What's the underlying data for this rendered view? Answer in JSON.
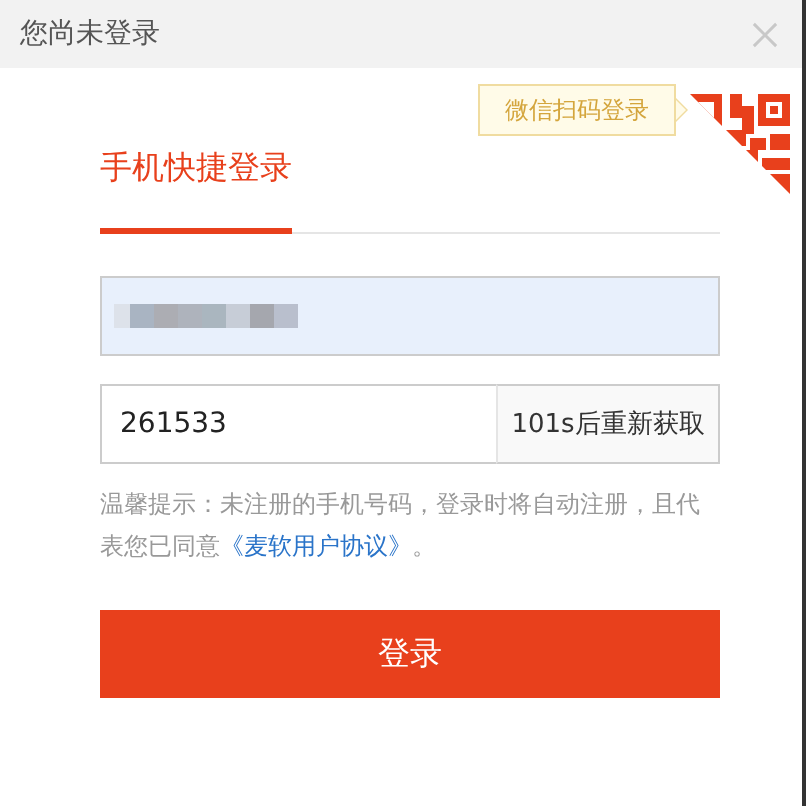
{
  "window": {
    "title": "您尚未登录"
  },
  "qr_tooltip": "微信扫码登录",
  "tabs": [
    {
      "label": "手机快捷登录",
      "selected": true
    }
  ],
  "phone_field": {
    "kind": "redacted"
  },
  "code_field": {
    "value": "261533",
    "resend": "101s后重新获取"
  },
  "notice": {
    "text": "温馨提示：未注册的手机号码，登录时将自动注册，且代表您已同意",
    "link": "《麦软用户协议》",
    "end": "。"
  },
  "login_button": "登录"
}
